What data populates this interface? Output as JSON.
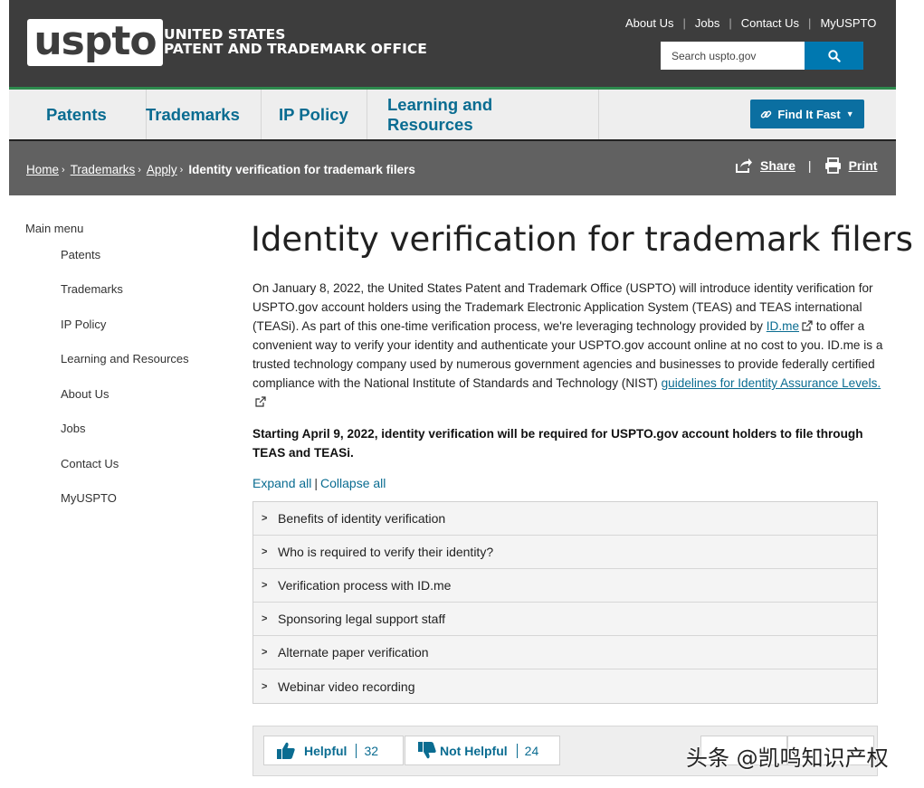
{
  "header": {
    "logo_text": "uspto",
    "org_line1": "UNITED STATES",
    "org_line2": "PATENT AND TRADEMARK OFFICE",
    "util_links": [
      "About Us",
      "Jobs",
      "Contact Us",
      "MyUSPTO"
    ],
    "search_placeholder": "Search uspto.gov"
  },
  "nav": {
    "items": [
      "Patents",
      "Trademarks",
      "IP Policy",
      "Learning and Resources"
    ],
    "find_it_fast": "Find It Fast"
  },
  "breadcrumb": {
    "links": [
      "Home",
      "Trademarks",
      "Apply"
    ],
    "current": "Identity verification for trademark filers",
    "share_label": "Share",
    "print_label": "Print"
  },
  "sidebar": {
    "heading": "Main menu",
    "items": [
      "Patents",
      "Trademarks",
      "IP Policy",
      "Learning and Resources",
      "About Us",
      "Jobs",
      "Contact Us",
      "MyUSPTO"
    ]
  },
  "main": {
    "title": "Identity verification for trademark filers",
    "para_part1": "On January 8, 2022, the United States Patent and Trademark Office (USPTO) will introduce identity verification for USPTO.gov account holders using the Trademark Electronic Application System (TEAS) and TEAS international (TEASi). As part of this one-time verification process, we're leveraging technology provided by",
    "para_link1": "ID.me",
    "para_part2": "to offer a convenient way to verify your identity and authenticate your USPTO.gov account online at no cost to you. ID.me is a trusted technology company used by numerous government agencies and businesses to provide federally certified compliance with the National Institute of Standards and Technology (NIST)",
    "para_link2": "guidelines for Identity Assurance Levels.",
    "bold_para": "Starting April 9, 2022, identity verification will be required for USPTO.gov account holders to file through TEAS and TEASi.",
    "expand_all": "Expand all",
    "collapse_all": "Collapse all",
    "accordion": [
      "Benefits of identity verification",
      "Who is required to verify their identity?",
      "Verification process with ID.me",
      "Sponsoring legal support staff",
      "Alternate paper verification",
      "Webinar video recording"
    ]
  },
  "feedback": {
    "helpful_label": "Helpful",
    "helpful_count": "32",
    "not_helpful_label": "Not Helpful",
    "not_helpful_count": "24"
  },
  "watermark": "头条 @凯鸣知识产权",
  "colors": {
    "header_bg": "#3d3d3d",
    "nav_bg": "#eeeeee",
    "accent_green": "#2d8a4d",
    "link_blue": "#0a6c91",
    "button_blue": "#0b6fa1",
    "crumb_bg": "#616161"
  }
}
